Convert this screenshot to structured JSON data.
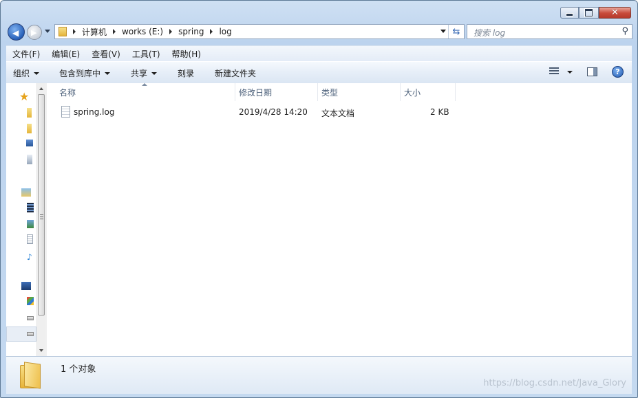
{
  "window": {
    "controls": {
      "minimize": "minimize",
      "maximize": "maximize",
      "close": "✕"
    }
  },
  "address_bar": {
    "breadcrumbs": [
      "计算机",
      "works (E:)",
      "spring",
      "log"
    ]
  },
  "search": {
    "placeholder": "搜索 log"
  },
  "menu": [
    "文件(F)",
    "编辑(E)",
    "查看(V)",
    "工具(T)",
    "帮助(H)"
  ],
  "toolbar": {
    "organize": "组织",
    "include_in_library": "包含到库中",
    "share": "共享",
    "burn": "刻录",
    "new_folder": "新建文件夹",
    "help": "?"
  },
  "columns": {
    "name": "名称",
    "modified": "修改日期",
    "type": "类型",
    "size": "大小"
  },
  "files": [
    {
      "name": "spring.log",
      "modified": "2019/4/28 14:20",
      "type": "文本文档",
      "size": "2 KB"
    }
  ],
  "status": {
    "count": "1 个对象"
  },
  "watermark": "https://blog.csdn.net/Java_Glory",
  "colors": {
    "accent": "#3467b3",
    "frame": "#c4d9f0",
    "close": "#c84a3a"
  }
}
